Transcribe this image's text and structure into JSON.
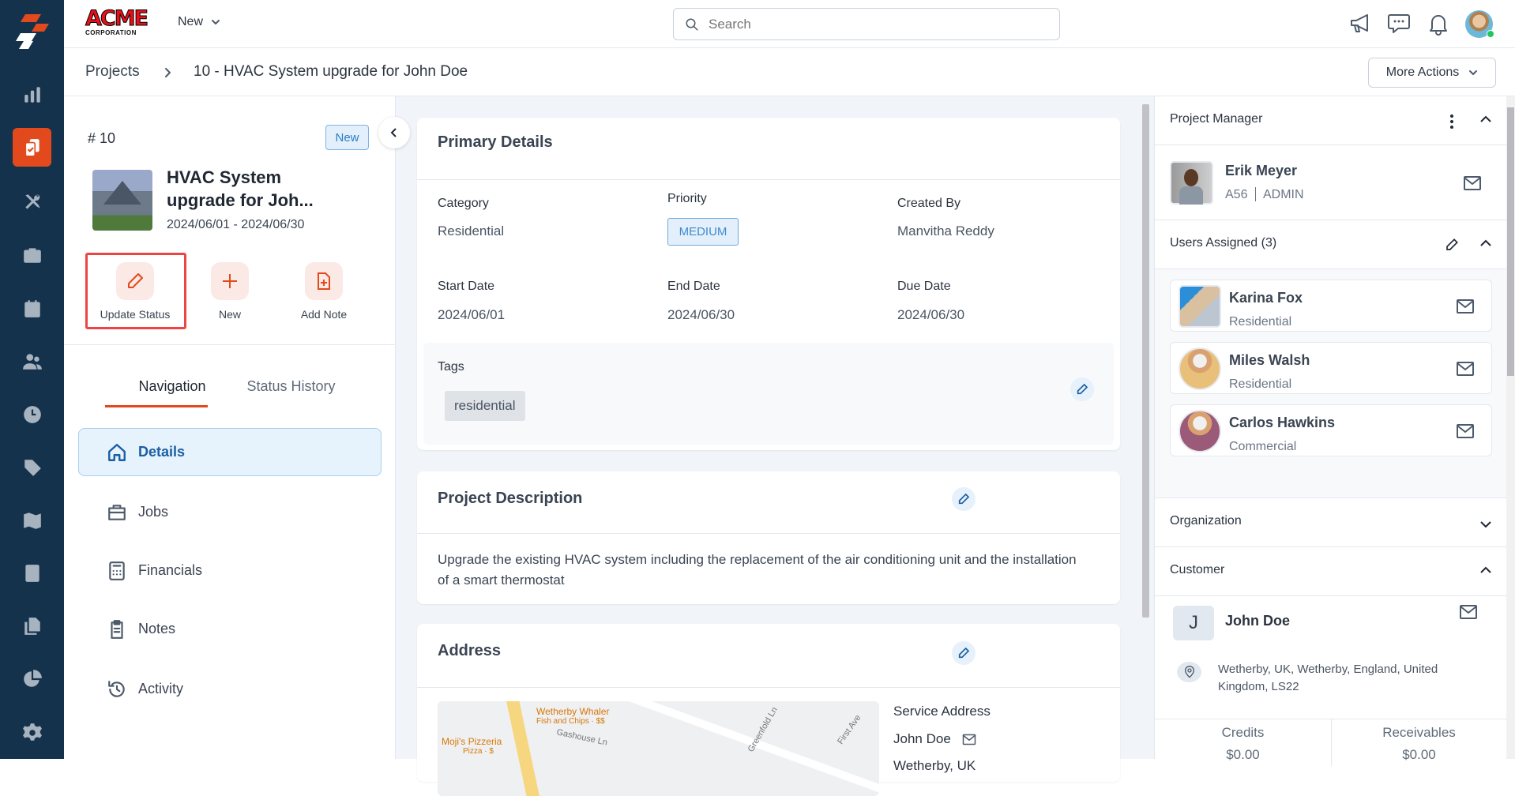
{
  "topbar": {
    "logo_text": "ACME CORPORATION",
    "new_label": "New",
    "search_placeholder": "Search",
    "avatar": "user-avatar"
  },
  "sidebar": {
    "items": [
      "dashboard",
      "projects",
      "tools",
      "jobs",
      "calendar",
      "users",
      "timesheets",
      "tags",
      "map",
      "calculator",
      "documents",
      "reports",
      "settings"
    ],
    "active": "projects"
  },
  "breadcrumb": {
    "root": "Projects",
    "current": "10 - HVAC System upgrade for John Doe"
  },
  "more_actions_label": "More Actions",
  "project": {
    "number": "# 10",
    "status": "New",
    "title_line1": "HVAC System",
    "title_line2": "upgrade for Joh...",
    "dates": "2024/06/01 - 2024/06/30"
  },
  "actions": [
    {
      "label": "Update Status"
    },
    {
      "label": "New"
    },
    {
      "label": "Add Note"
    }
  ],
  "tabs": [
    {
      "label": "Navigation",
      "active": true
    },
    {
      "label": "Status History",
      "active": false
    }
  ],
  "nav": [
    {
      "label": "Details"
    },
    {
      "label": "Jobs"
    },
    {
      "label": "Financials"
    },
    {
      "label": "Notes"
    },
    {
      "label": "Activity"
    }
  ],
  "primary": {
    "title": "Primary Details",
    "category_label": "Category",
    "category": "Residential",
    "priority_label": "Priority",
    "priority": "MEDIUM",
    "created_by_label": "Created By",
    "created_by": "Manvitha Reddy",
    "start_label": "Start Date",
    "start": "2024/06/01",
    "end_label": "End Date",
    "end": "2024/06/30",
    "due_label": "Due Date",
    "due": "2024/06/30",
    "tags_label": "Tags",
    "tags": [
      "residential"
    ]
  },
  "description": {
    "title": "Project Description",
    "text": "Upgrade the existing HVAC system including the replacement of the air conditioning unit and the installation of a smart thermostat"
  },
  "address": {
    "title": "Address",
    "service_label": "Service Address",
    "name": "John Doe",
    "line_partial": "Wetherby, UK",
    "map_labels": {
      "poi1": "Wetherby Whaler",
      "poi1_sub": "Fish and Chips · $$",
      "poi2": "Moji's Pizzeria",
      "poi2_sub": "Pizza · $",
      "street1": "Gashouse Ln",
      "street2": "Greenfold Ln",
      "street3": "First Ave"
    }
  },
  "right": {
    "pm_title": "Project Manager",
    "pm": {
      "name": "Erik Meyer",
      "code": "A56",
      "role": "ADMIN"
    },
    "users_title": "Users Assigned (3)",
    "users": [
      {
        "name": "Karina Fox",
        "sub": "Residential"
      },
      {
        "name": "Miles Walsh",
        "sub": "Residential"
      },
      {
        "name": "Carlos Hawkins",
        "sub": "Commercial"
      }
    ],
    "org_title": "Organization",
    "customer_title": "Customer",
    "customer": {
      "initial": "J",
      "name": "John Doe",
      "address": "Wetherby, UK, Wetherby, England, United Kingdom, LS22"
    },
    "credits_label": "Credits",
    "credits": "$0.00",
    "receivables_label": "Receivables",
    "receivables": "$0.00"
  },
  "colors": {
    "sidebar": "#15324d",
    "accent": "#e24a1d",
    "link": "#1f5fa8"
  }
}
